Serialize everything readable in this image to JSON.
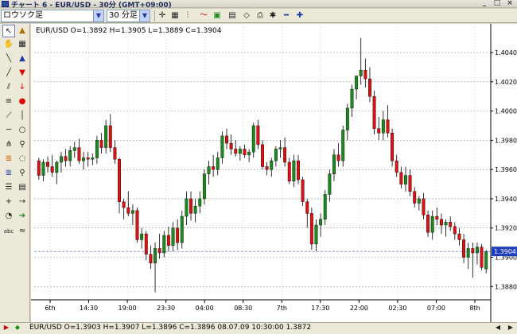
{
  "window": {
    "title": "チャート 6 - EUR/USD - 30分 (GMT+09:00)",
    "controls": [
      "_",
      "□",
      "×"
    ]
  },
  "toolbar": {
    "chart_type_value": "ロウソク足",
    "timeframe_value": "30 分足"
  },
  "statusbar": {
    "text": "EUR/USD O=1.3903 H=1.3907 L=1.3896 C=1.3896   08.07.09 10:30:00   1.3872"
  },
  "chart": {
    "info_label": "EUR/USD O=1.3892 H=1.3905 L=1.3889 C=1.3904",
    "current_price_label": "1.3904",
    "colors": {
      "up": "#1c8a1c",
      "down": "#e01010",
      "grid": "#999999",
      "price_tag": "#1f3fbf"
    }
  },
  "chart_data": {
    "type": "candlestick",
    "ylim": [
      1.3872,
      1.4052
    ],
    "yticks": [
      "1.4040",
      "1.4020",
      "1.4000",
      "1.3980",
      "1.3960",
      "1.3940",
      "1.3920",
      "1.3900",
      "1.3880"
    ],
    "xticks": [
      "6th",
      "14:30",
      "19:00",
      "23:30",
      "04:00",
      "08:30",
      "7th",
      "17:30",
      "22:00",
      "02:30",
      "07:00",
      "8th"
    ],
    "ohlc": [
      [
        1.3966,
        1.3968,
        1.3953,
        1.3956
      ],
      [
        1.3956,
        1.3967,
        1.3952,
        1.3965
      ],
      [
        1.3965,
        1.3969,
        1.3958,
        1.3962
      ],
      [
        1.3962,
        1.397,
        1.3955,
        1.3958
      ],
      [
        1.3958,
        1.3966,
        1.395,
        1.3965
      ],
      [
        1.3965,
        1.3972,
        1.3958,
        1.3969
      ],
      [
        1.3969,
        1.3974,
        1.3962,
        1.3966
      ],
      [
        1.3966,
        1.3976,
        1.3962,
        1.3973
      ],
      [
        1.3973,
        1.3979,
        1.3968,
        1.3975
      ],
      [
        1.3975,
        1.3981,
        1.3964,
        1.3966
      ],
      [
        1.3966,
        1.3972,
        1.396,
        1.3968
      ],
      [
        1.3968,
        1.3972,
        1.3962,
        1.3967
      ],
      [
        1.3967,
        1.3971,
        1.3963,
        1.3968
      ],
      [
        1.3968,
        1.3983,
        1.3964,
        1.398
      ],
      [
        1.398,
        1.3985,
        1.3971,
        1.3975
      ],
      [
        1.3975,
        1.3994,
        1.3971,
        1.399
      ],
      [
        1.399,
        1.3998,
        1.3972,
        1.3975
      ],
      [
        1.3975,
        1.398,
        1.3964,
        1.3967
      ],
      [
        1.3967,
        1.3968,
        1.393,
        1.3938
      ],
      [
        1.3938,
        1.394,
        1.3926,
        1.3934
      ],
      [
        1.3934,
        1.3945,
        1.3928,
        1.393
      ],
      [
        1.393,
        1.3936,
        1.3922,
        1.3932
      ],
      [
        1.3932,
        1.3934,
        1.391,
        1.3912
      ],
      [
        1.3912,
        1.392,
        1.3906,
        1.3916
      ],
      [
        1.3916,
        1.3918,
        1.3898,
        1.3902
      ],
      [
        1.3902,
        1.3908,
        1.3892,
        1.3896
      ],
      [
        1.3896,
        1.391,
        1.3876,
        1.3906
      ],
      [
        1.3906,
        1.3916,
        1.3899,
        1.3903
      ],
      [
        1.3903,
        1.3918,
        1.39,
        1.3915
      ],
      [
        1.3915,
        1.3921,
        1.3904,
        1.3908
      ],
      [
        1.3908,
        1.3924,
        1.3904,
        1.392
      ],
      [
        1.392,
        1.3926,
        1.3905,
        1.391
      ],
      [
        1.391,
        1.3932,
        1.3906,
        1.3928
      ],
      [
        1.3928,
        1.3945,
        1.3922,
        1.394
      ],
      [
        1.394,
        1.3945,
        1.3925,
        1.393
      ],
      [
        1.393,
        1.394,
        1.3924,
        1.3935
      ],
      [
        1.3935,
        1.3945,
        1.393,
        1.394
      ],
      [
        1.394,
        1.396,
        1.3936,
        1.3957
      ],
      [
        1.3957,
        1.3966,
        1.395,
        1.3962
      ],
      [
        1.3962,
        1.397,
        1.3955,
        1.396
      ],
      [
        1.396,
        1.3972,
        1.3956,
        1.3968
      ],
      [
        1.3968,
        1.3986,
        1.3964,
        1.3983
      ],
      [
        1.3983,
        1.3988,
        1.3974,
        1.3978
      ],
      [
        1.3978,
        1.3984,
        1.397,
        1.3974
      ],
      [
        1.3974,
        1.398,
        1.3969,
        1.3971
      ],
      [
        1.3971,
        1.3976,
        1.3966,
        1.3974
      ],
      [
        1.3974,
        1.3977,
        1.3968,
        1.397
      ],
      [
        1.397,
        1.3974,
        1.3965,
        1.3972
      ],
      [
        1.3972,
        1.3992,
        1.3968,
        1.399
      ],
      [
        1.399,
        1.3994,
        1.3974,
        1.3977
      ],
      [
        1.3977,
        1.398,
        1.396,
        1.3962
      ],
      [
        1.3962,
        1.3965,
        1.3956,
        1.396
      ],
      [
        1.396,
        1.3968,
        1.3955,
        1.3966
      ],
      [
        1.3966,
        1.3976,
        1.3962,
        1.3974
      ],
      [
        1.3974,
        1.398,
        1.3968,
        1.3975
      ],
      [
        1.3975,
        1.3982,
        1.3962,
        1.3965
      ],
      [
        1.3965,
        1.3968,
        1.395,
        1.3952
      ],
      [
        1.3952,
        1.397,
        1.3948,
        1.3966
      ],
      [
        1.3966,
        1.397,
        1.395,
        1.3953
      ],
      [
        1.3953,
        1.3955,
        1.3935,
        1.3938
      ],
      [
        1.3938,
        1.394,
        1.392,
        1.393
      ],
      [
        1.393,
        1.3934,
        1.3905,
        1.3909
      ],
      [
        1.3909,
        1.3926,
        1.3904,
        1.3922
      ],
      [
        1.3922,
        1.393,
        1.3914,
        1.3926
      ],
      [
        1.3926,
        1.3946,
        1.3922,
        1.3943
      ],
      [
        1.3943,
        1.396,
        1.3938,
        1.3957
      ],
      [
        1.3957,
        1.3974,
        1.3952,
        1.397
      ],
      [
        1.397,
        1.3978,
        1.3962,
        1.3966
      ],
      [
        1.3966,
        1.399,
        1.3962,
        1.3987
      ],
      [
        1.3987,
        1.4005,
        1.398,
        1.4002
      ],
      [
        1.4002,
        1.4018,
        1.3996,
        1.4015
      ],
      [
        1.4015,
        1.4022,
        1.4008,
        1.4024
      ],
      [
        1.4024,
        1.405,
        1.4018,
        1.4028
      ],
      [
        1.4028,
        1.4036,
        1.4016,
        1.4022
      ],
      [
        1.4022,
        1.403,
        1.4006,
        1.401
      ],
      [
        1.401,
        1.4014,
        1.3984,
        1.3988
      ],
      [
        1.3988,
        1.3996,
        1.398,
        1.3985
      ],
      [
        1.3985,
        1.4,
        1.398,
        1.3994
      ],
      [
        1.3994,
        1.4004,
        1.3982,
        1.3985
      ],
      [
        1.3985,
        1.3988,
        1.3962,
        1.3966
      ],
      [
        1.3966,
        1.397,
        1.3955,
        1.3958
      ],
      [
        1.3958,
        1.3962,
        1.3947,
        1.395
      ],
      [
        1.395,
        1.3962,
        1.3945,
        1.3956
      ],
      [
        1.3956,
        1.396,
        1.3942,
        1.3945
      ],
      [
        1.3945,
        1.3948,
        1.3934,
        1.3937
      ],
      [
        1.3937,
        1.3942,
        1.3932,
        1.394
      ],
      [
        1.394,
        1.3944,
        1.3926,
        1.3929
      ],
      [
        1.3929,
        1.3932,
        1.3914,
        1.3917
      ],
      [
        1.3917,
        1.3932,
        1.3912,
        1.3928
      ],
      [
        1.3928,
        1.3934,
        1.3922,
        1.3926
      ],
      [
        1.3926,
        1.393,
        1.3916,
        1.3922
      ],
      [
        1.3922,
        1.3926,
        1.3914,
        1.3924
      ],
      [
        1.3924,
        1.3928,
        1.3918,
        1.3921
      ],
      [
        1.3921,
        1.3924,
        1.3912,
        1.3916
      ],
      [
        1.3916,
        1.392,
        1.3908,
        1.3912
      ],
      [
        1.3912,
        1.3916,
        1.3896,
        1.39
      ],
      [
        1.39,
        1.391,
        1.3892,
        1.3906
      ],
      [
        1.3906,
        1.391,
        1.3886,
        1.3903
      ],
      [
        1.3903,
        1.391,
        1.3895,
        1.3907
      ],
      [
        1.3907,
        1.3909,
        1.3891,
        1.3893
      ],
      [
        1.3892,
        1.3905,
        1.3889,
        1.3904
      ]
    ]
  }
}
